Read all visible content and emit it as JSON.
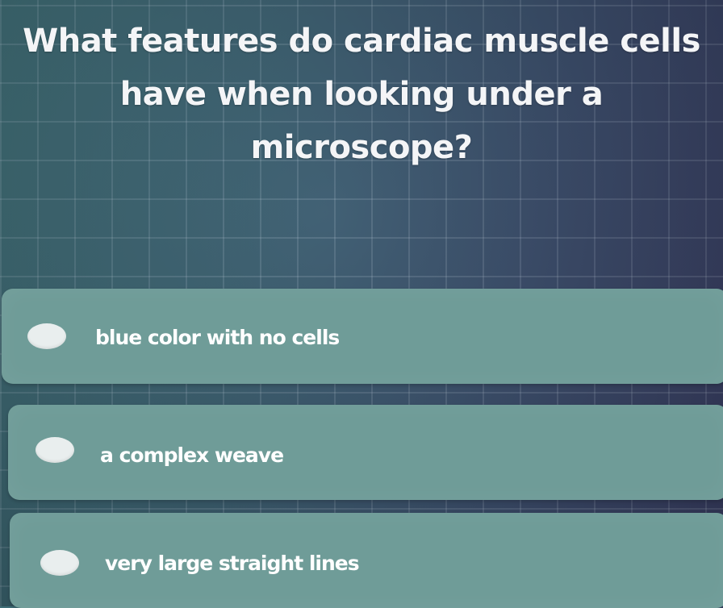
{
  "quiz": {
    "question": "What features do cardiac muscle cells have when looking under a microscope?",
    "options": [
      {
        "label": "blue color with no cells"
      },
      {
        "label": "a complex weave"
      },
      {
        "label": "very large straight lines"
      }
    ]
  }
}
